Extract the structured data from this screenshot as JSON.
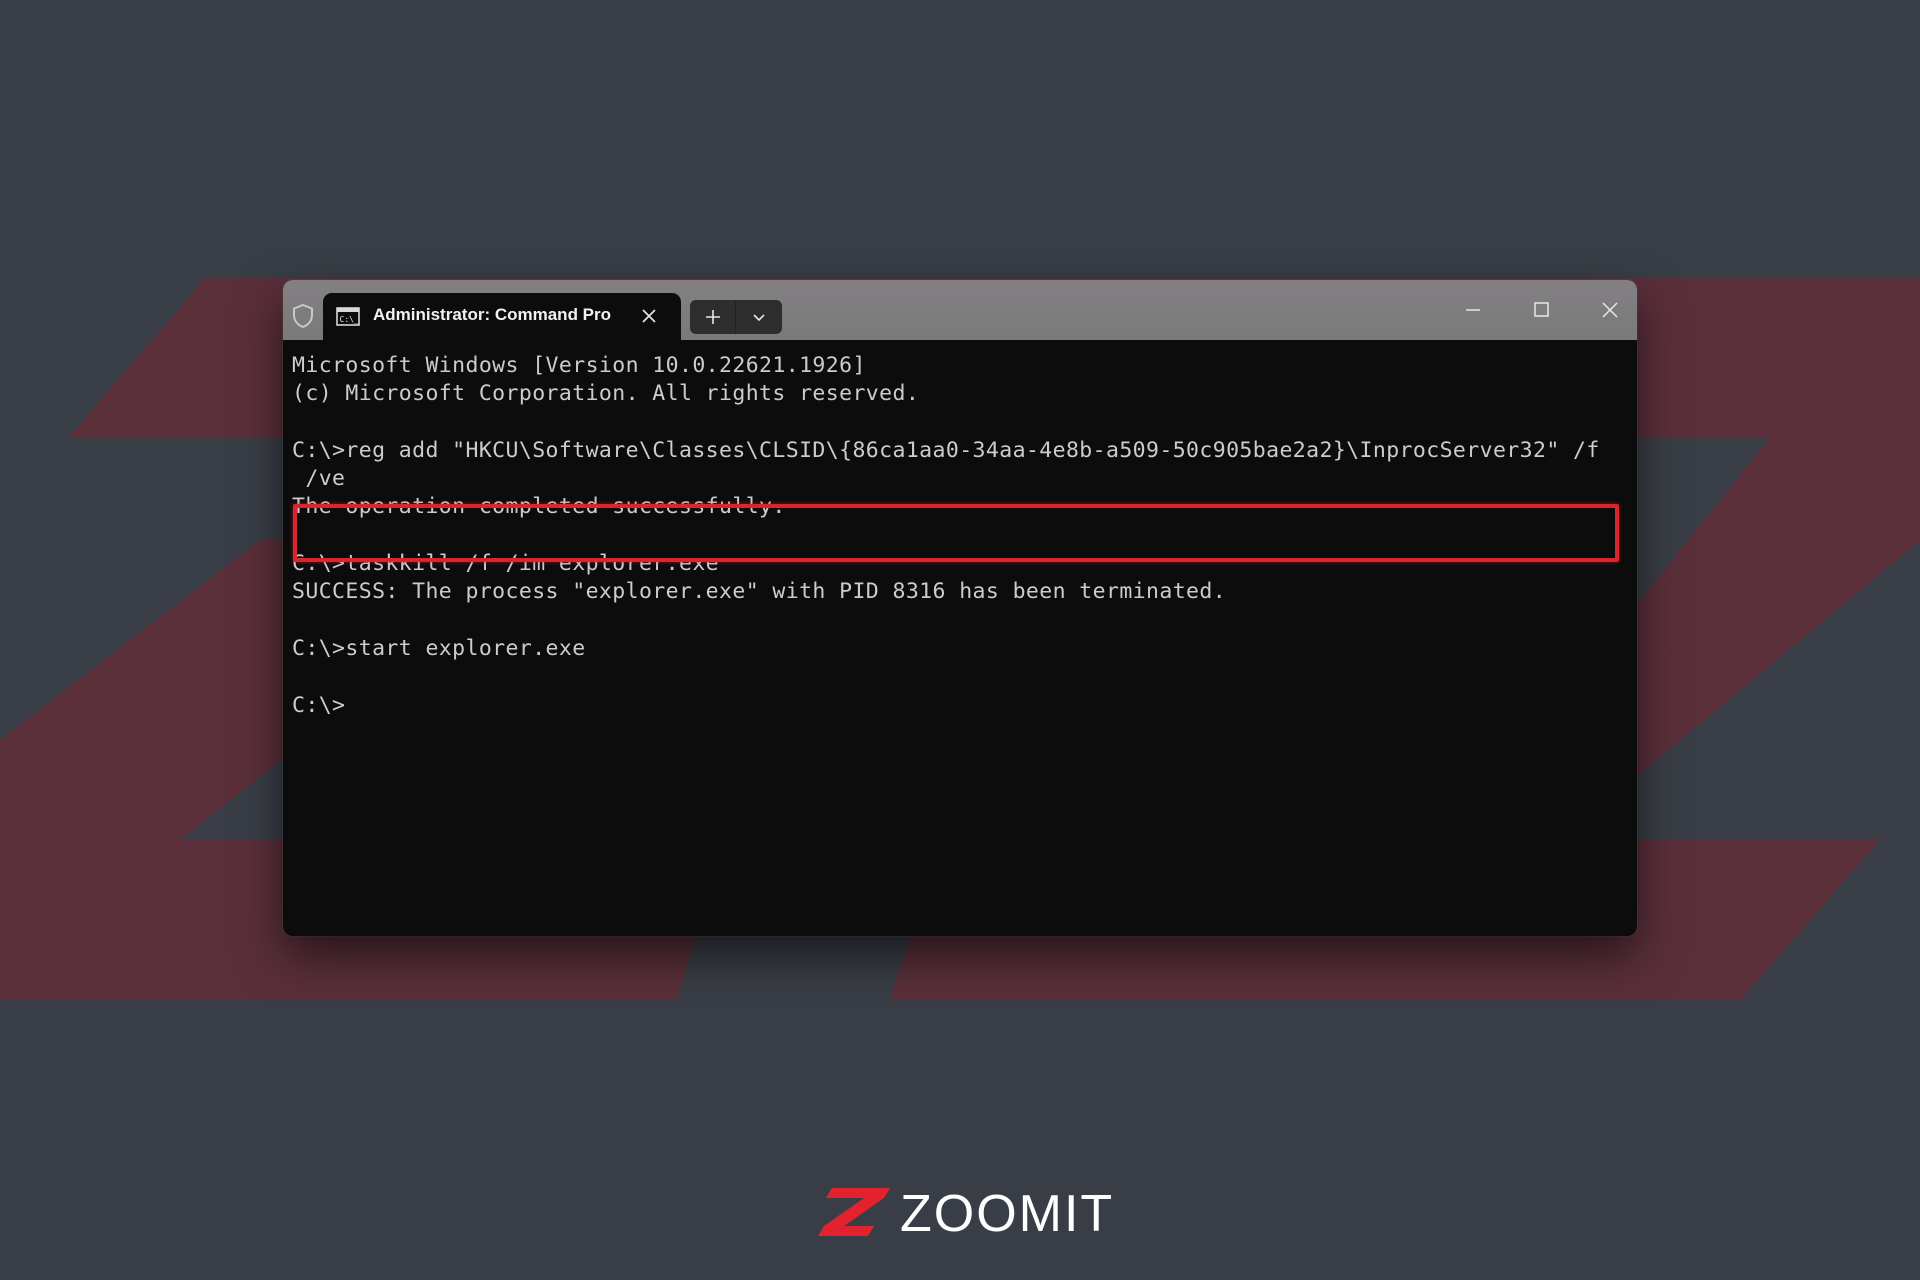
{
  "colors": {
    "background": "#393d45",
    "accent_shape": "#5a2f3a",
    "highlight": "#d9262e",
    "brand_red": "#e2232f"
  },
  "window": {
    "tab_title": "Administrator: Command Pro",
    "icons": {
      "admin": "shield-icon",
      "tab": "command-prompt-icon",
      "tab_close": "close-icon",
      "new_tab": "plus-icon",
      "dropdown": "chevron-down-icon",
      "minimize": "minimize-icon",
      "maximize": "maximize-icon",
      "close": "close-icon"
    }
  },
  "terminal": {
    "lines": [
      "Microsoft Windows [Version 10.0.22621.1926]",
      "(c) Microsoft Corporation. All rights reserved.",
      "",
      "C:\\>reg add \"HKCU\\Software\\Classes\\CLSID\\{86ca1aa0-34aa-4e8b-a509-50c905bae2a2}\\InprocServer32\" /f",
      " /ve",
      "The operation completed successfully.",
      "",
      "C:\\>taskkill /f /im explorer.exe",
      "SUCCESS: The process \"explorer.exe\" with PID 8316 has been terminated.",
      "",
      "C:\\>start explorer.exe",
      "",
      "C:\\>"
    ],
    "highlighted_command": "reg add \"HKCU\\Software\\Classes\\CLSID\\{86ca1aa0-34aa-4e8b-a509-50c905bae2a2}\\InprocServer32\" /f /ve"
  },
  "branding": {
    "logo_text": "ZOOMIT"
  }
}
